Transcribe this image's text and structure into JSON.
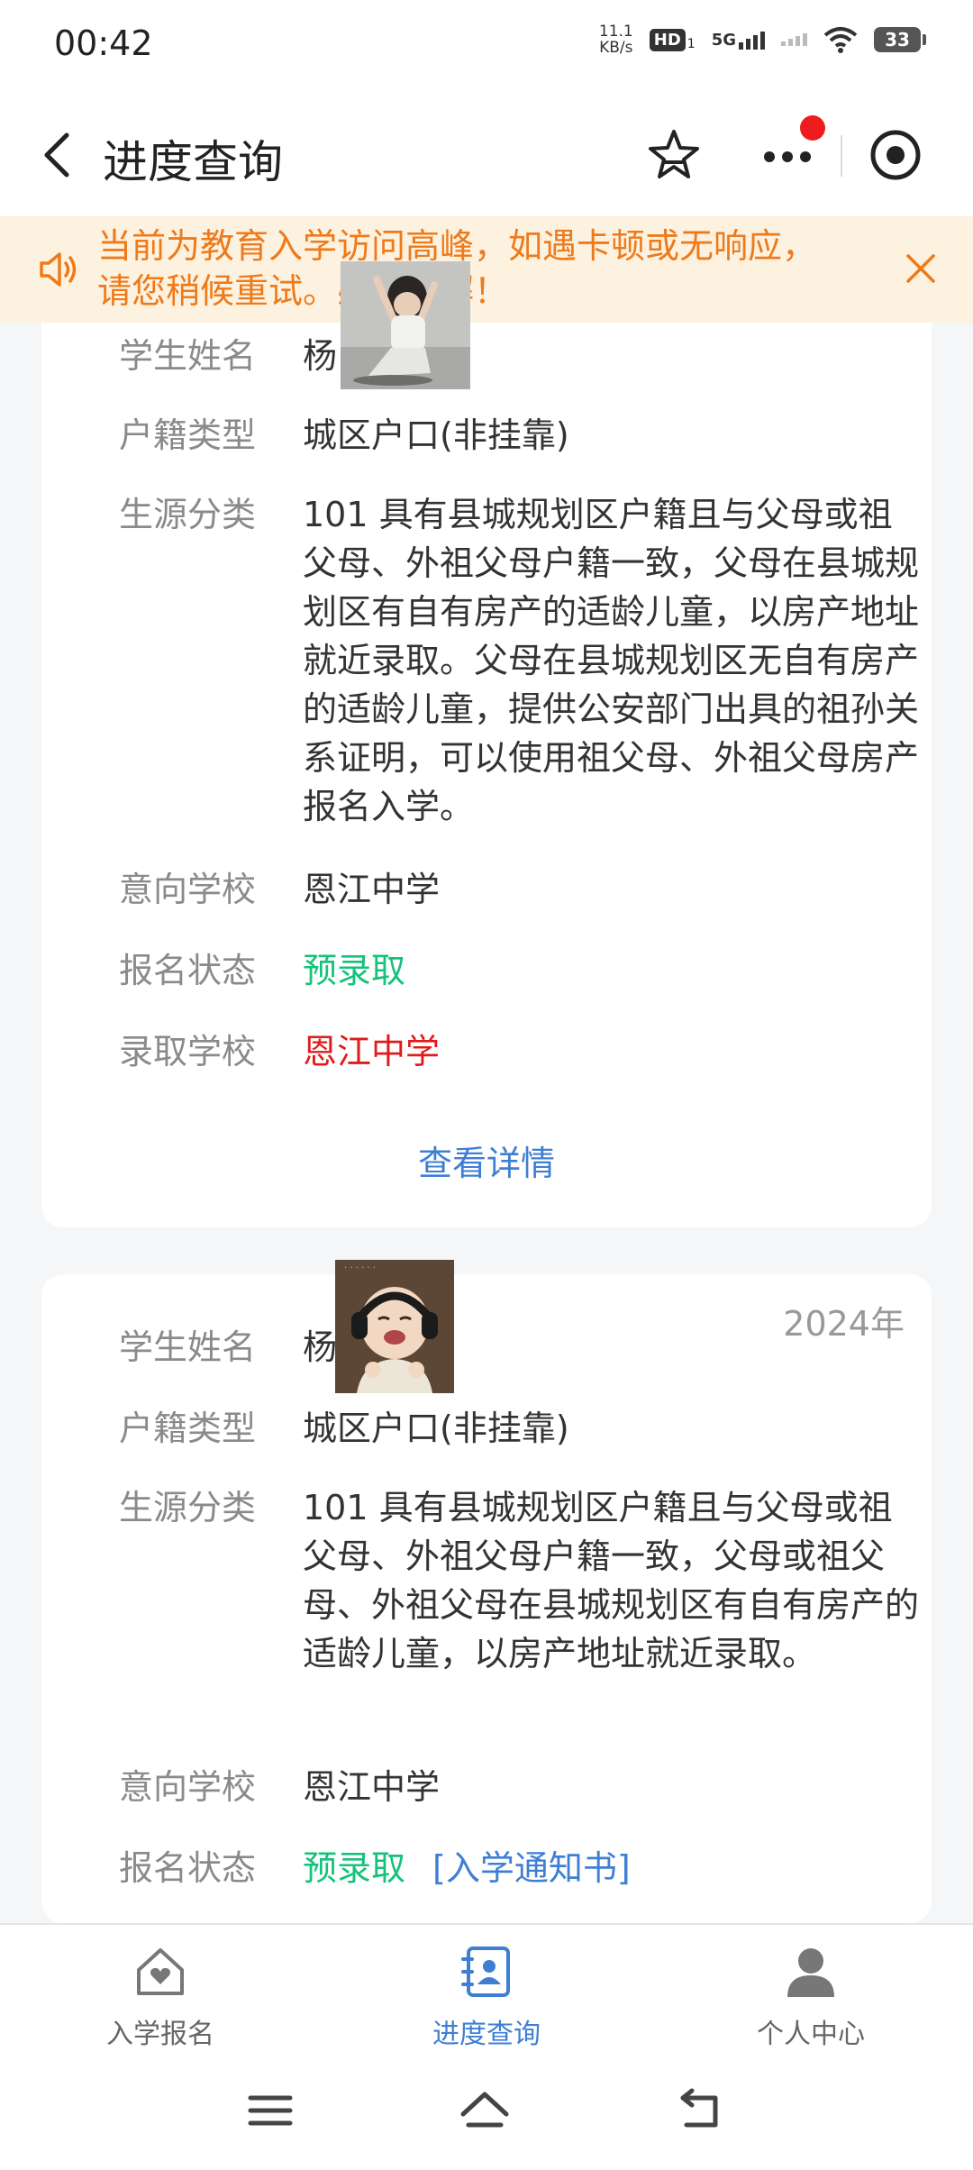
{
  "status_bar": {
    "time": "00:42",
    "speed_value": "11.1",
    "speed_unit": "KB/s",
    "hd": "HD",
    "hd_sub": "1",
    "network": "5G",
    "battery": "33"
  },
  "header": {
    "title": "进度查询"
  },
  "notice": {
    "text": "当前为教育入学访问高峰，如遇卡顿或无响应，请您稍候重试。感谢理解！"
  },
  "card1": {
    "fields": [
      {
        "label": "学生姓名",
        "value": "杨"
      },
      {
        "label": "户籍类型",
        "value": "城区户口(非挂靠)"
      },
      {
        "label": "生源分类",
        "value": "101 具有县城规划区户籍且与父母或祖父母、外祖父母户籍一致，父母在县城规划区有自有房产的适龄儿童，以房产地址就近录取。父母在县城规划区无自有房产的适龄儿童，提供公安部门出具的祖孙关系证明，可以使用祖父母、外祖父母房产报名入学。"
      },
      {
        "label": "意向学校",
        "value": "恩江中学"
      },
      {
        "label": "报名状态",
        "value": "预录取"
      },
      {
        "label": "录取学校",
        "value": "恩江中学"
      }
    ],
    "details_link": "查看详情"
  },
  "card2": {
    "year": "2024年",
    "fields": [
      {
        "label": "学生姓名",
        "value": "杨"
      },
      {
        "label": "户籍类型",
        "value": "城区户口(非挂靠)"
      },
      {
        "label": "生源分类",
        "value": "101 具有县城规划区户籍且与父母或祖父母、外祖父母户籍一致，父母或祖父母、外祖父母在县城规划区有自有房产的适龄儿童，以房产地址就近录取。"
      },
      {
        "label": "意向学校",
        "value": "恩江中学"
      },
      {
        "label": "报名状态",
        "value": "预录取"
      }
    ],
    "notice_link": "[入学通知书]"
  },
  "bottom_nav": {
    "items": [
      {
        "label": "入学报名",
        "icon": "home-heart-icon"
      },
      {
        "label": "进度查询",
        "icon": "contacts-book-icon"
      },
      {
        "label": "个人中心",
        "icon": "person-icon"
      }
    ],
    "active_index": 1
  },
  "colors": {
    "accent": "#3f7fd3",
    "success": "#15c27a",
    "danger": "#e11b1b",
    "notice_text": "#ee7a1a",
    "notice_bg": "#fdf2e0"
  }
}
